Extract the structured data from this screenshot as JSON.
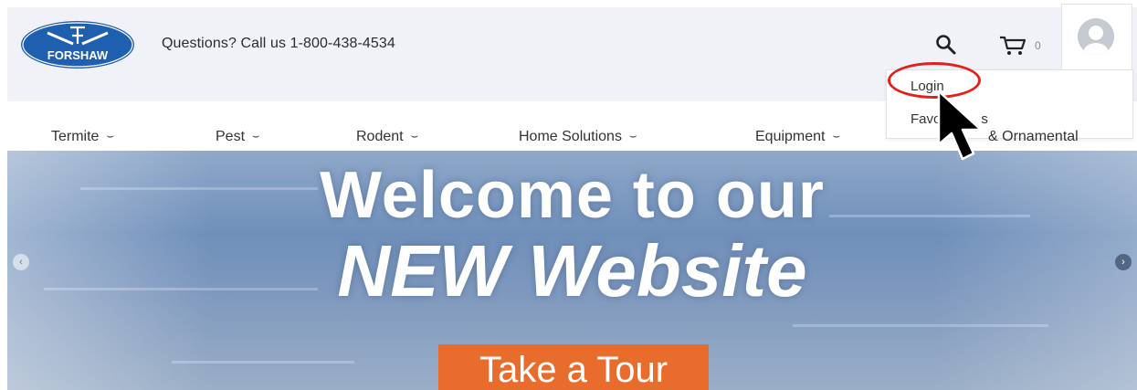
{
  "header": {
    "logo_text": "FORSHAW",
    "phone_text": "Questions? Call us 1-800-438-4534",
    "cart_count": "0",
    "icons": [
      "search-icon",
      "cart-icon",
      "user-avatar-icon"
    ]
  },
  "account_menu": {
    "items": [
      {
        "label": "Login"
      },
      {
        "label": "Favo"
      },
      {
        "label": "s"
      }
    ]
  },
  "nav": {
    "items": [
      {
        "label": "Termite"
      },
      {
        "label": "Pest"
      },
      {
        "label": "Rodent"
      },
      {
        "label": "Home Solutions"
      },
      {
        "label": "Equipment"
      },
      {
        "label": "& Ornamental"
      }
    ],
    "chevron": "⌣"
  },
  "hero": {
    "line1": "Welcome to our",
    "line2": "NEW Website",
    "cta_label": "Take a Tour",
    "prev_arrow": "‹",
    "next_arrow": "›"
  },
  "colors": {
    "brand_blue": "#1f5fb0",
    "cta_orange": "#e86d2d",
    "highlight_red": "#e3201b"
  }
}
